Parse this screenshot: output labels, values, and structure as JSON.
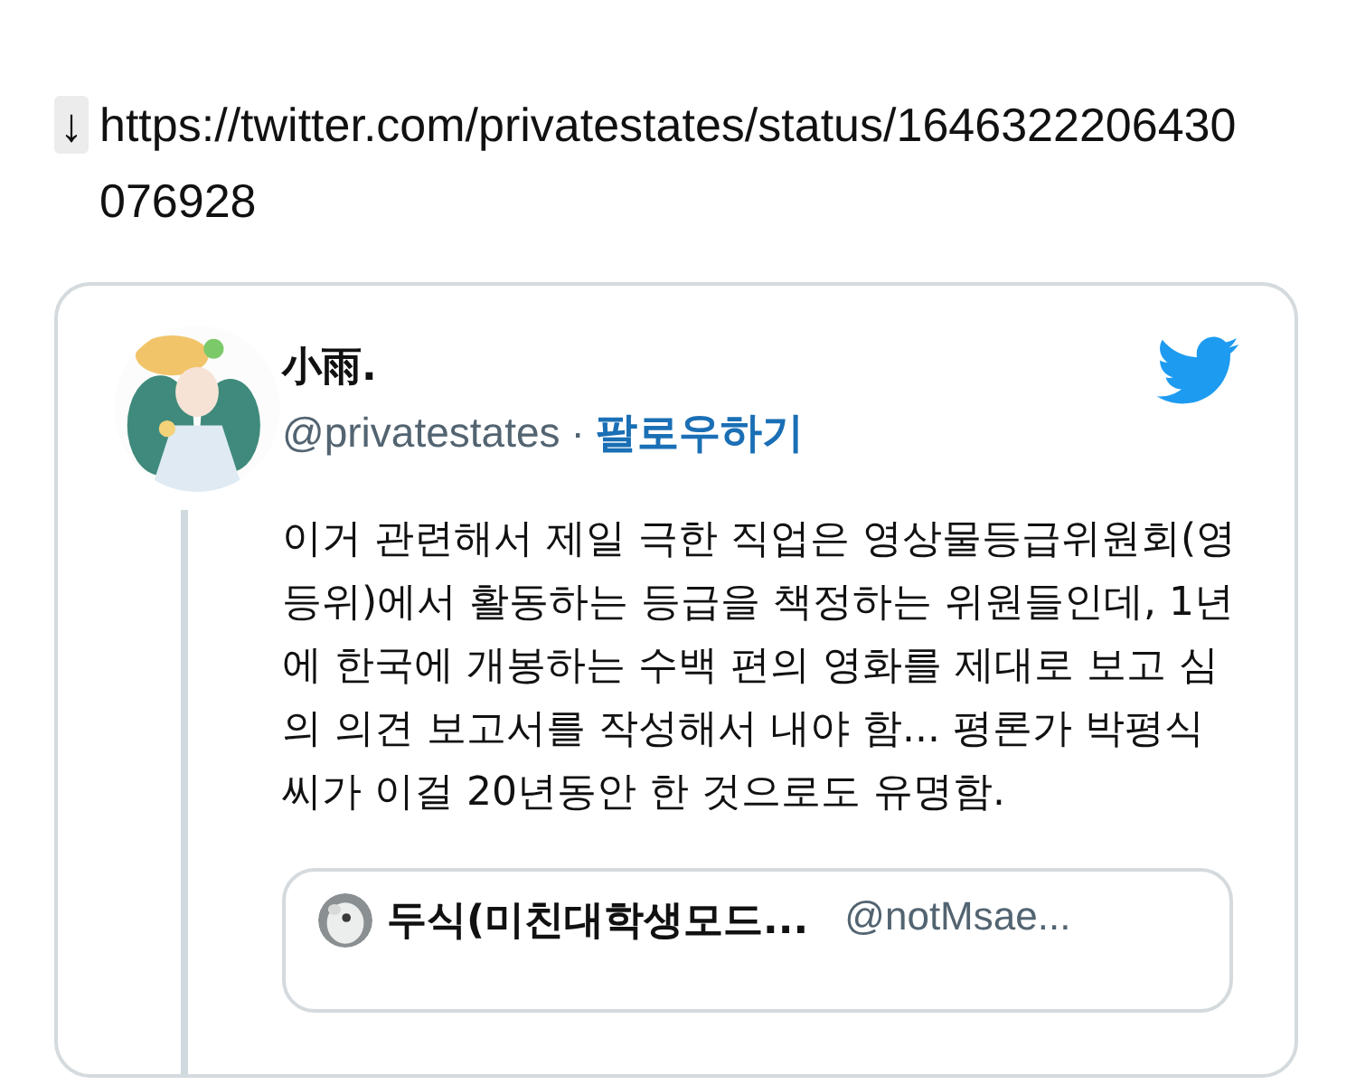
{
  "link": {
    "arrow": "↓",
    "url": "https://twitter.com/privatestates/status/1646322206430076928"
  },
  "tweet": {
    "name": "小雨.",
    "handle": "@privatestates",
    "separator": "·",
    "follow": "팔로우하기",
    "text": "이거 관련해서 제일 극한 직업은 영상물등급위원회(영등위)에서 활동하는 등급을 책정하는 위원들인데, 1년에 한국에 개봉하는 수백 편의 영화를 제대로 보고 심의 의견 보고서를 작성해서 내야 함... 평론가 박평식씨가 이걸 20년동안 한 것으로도 유명함.",
    "quote": {
      "name": "두식(미친대학생모드...",
      "handle": "@notMsae..."
    }
  }
}
